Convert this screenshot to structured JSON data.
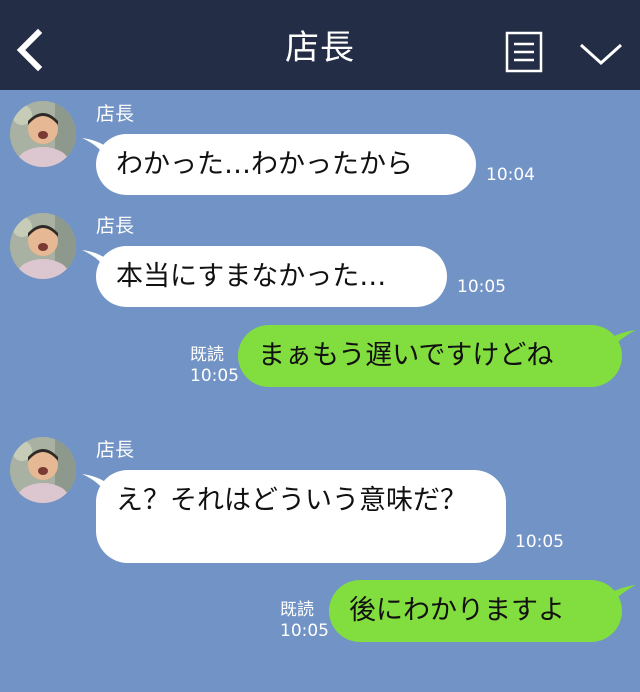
{
  "header": {
    "title": "店長",
    "icons": [
      "back-icon",
      "menu-icon",
      "chevron-down-icon"
    ],
    "background": "#232d46"
  },
  "chat_background": "#7293c5",
  "colors": {
    "incoming_bubble": "#ffffff",
    "outgoing_bubble": "#82dd3e",
    "meta_text": "#ffffff"
  },
  "messages": [
    {
      "direction": "incoming",
      "sender": "店長",
      "text": "わかった…わかったから",
      "time": "10:04"
    },
    {
      "direction": "incoming",
      "sender": "店長",
      "text": "本当にすまなかった…",
      "time": "10:05"
    },
    {
      "direction": "outgoing",
      "read_label": "既読",
      "text": "まぁもう遅いですけどね",
      "time": "10:05"
    },
    {
      "direction": "incoming",
      "sender": "店長",
      "text": "え？それはどういう意味だ？",
      "time": "10:05"
    },
    {
      "direction": "outgoing",
      "read_label": "既読",
      "text": "後にわかりますよ",
      "time": "10:05"
    }
  ]
}
